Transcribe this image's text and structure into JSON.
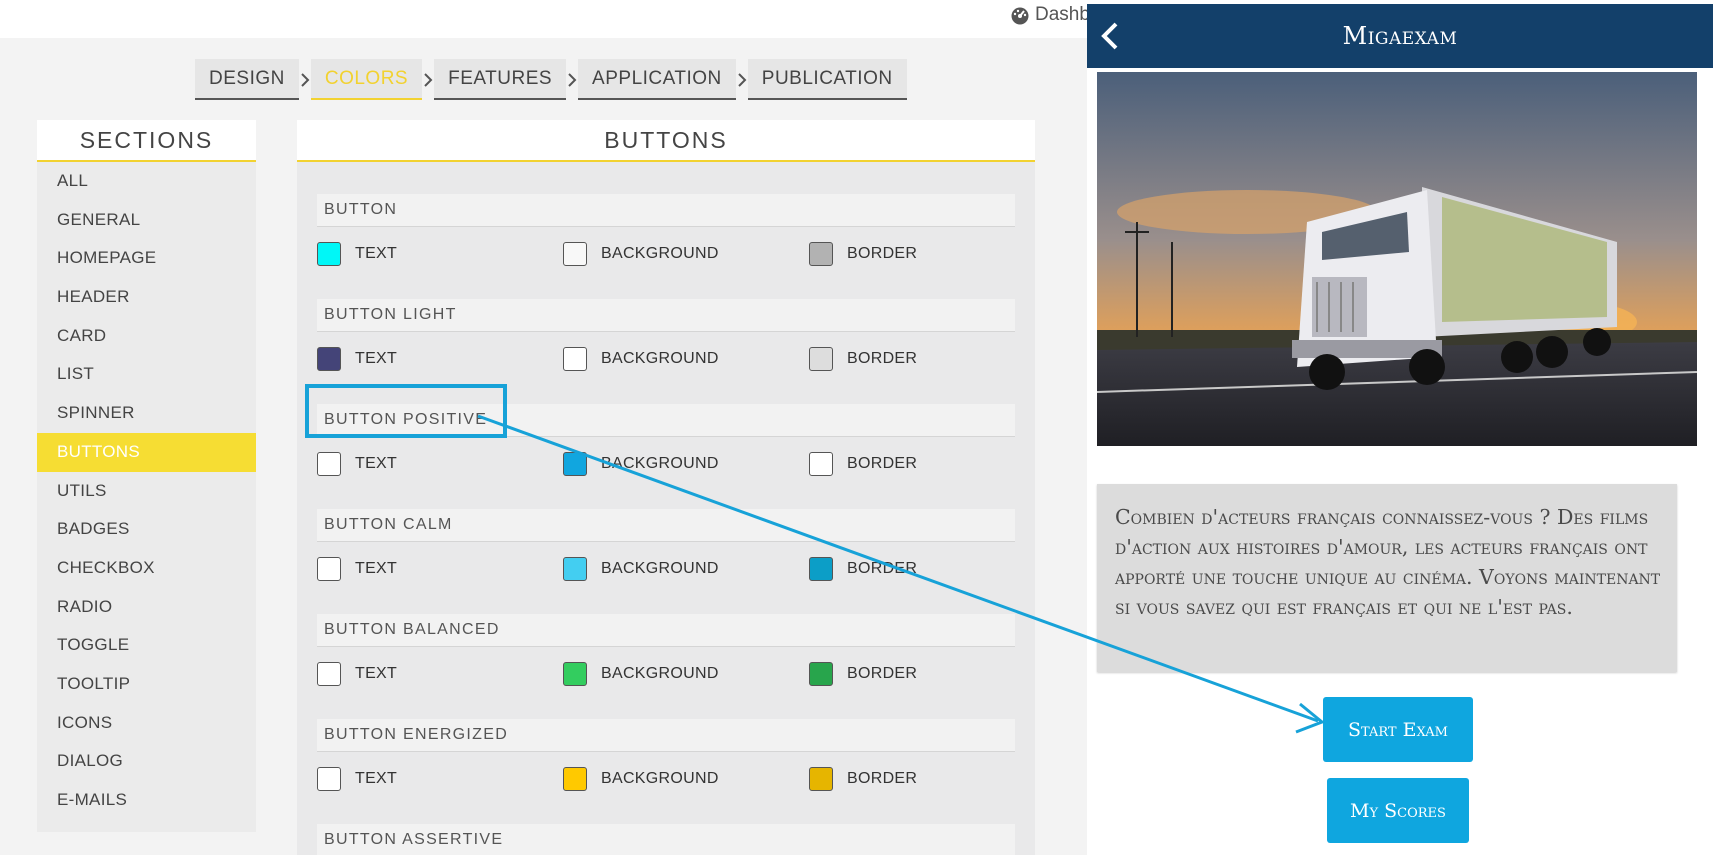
{
  "topbar": {
    "dashboard_label": "Dashb"
  },
  "steps": [
    {
      "label": "DESIGN",
      "active": false
    },
    {
      "label": "COLORS",
      "active": true
    },
    {
      "label": "FEATURES",
      "active": false
    },
    {
      "label": "APPLICATION",
      "active": false
    },
    {
      "label": "PUBLICATION",
      "active": false
    }
  ],
  "sections": {
    "title": "SECTIONS",
    "items": [
      "ALL",
      "GENERAL",
      "HOMEPAGE",
      "HEADER",
      "CARD",
      "LIST",
      "SPINNER",
      "BUTTONS",
      "UTILS",
      "BADGES",
      "CHECKBOX",
      "RADIO",
      "TOGGLE",
      "TOOLTIP",
      "ICONS",
      "DIALOG",
      "E-MAILS"
    ],
    "active": "BUTTONS"
  },
  "panel": {
    "title": "BUTTONS",
    "groups": [
      {
        "name": "BUTTON",
        "swatches": [
          {
            "label": "TEXT",
            "color": "#00f7f7"
          },
          {
            "label": "BACKGROUND",
            "color": "#f8f8f8"
          },
          {
            "label": "BORDER",
            "color": "#b2b2b2"
          }
        ]
      },
      {
        "name": "BUTTON LIGHT",
        "swatches": [
          {
            "label": "TEXT",
            "color": "#444478"
          },
          {
            "label": "BACKGROUND",
            "color": "#ffffff"
          },
          {
            "label": "BORDER",
            "color": "#dddddd"
          }
        ]
      },
      {
        "name": "BUTTON POSITIVE",
        "swatches": [
          {
            "label": "TEXT",
            "color": "#ffffff"
          },
          {
            "label": "BACKGROUND",
            "color": "#11a6df"
          },
          {
            "label": "BORDER",
            "color": "#ffffff"
          }
        ]
      },
      {
        "name": "BUTTON CALM",
        "swatches": [
          {
            "label": "TEXT",
            "color": "#ffffff"
          },
          {
            "label": "BACKGROUND",
            "color": "#43cef1"
          },
          {
            "label": "BORDER",
            "color": "#0c9ec7"
          }
        ]
      },
      {
        "name": "BUTTON BALANCED",
        "swatches": [
          {
            "label": "TEXT",
            "color": "#ffffff"
          },
          {
            "label": "BACKGROUND",
            "color": "#33cd5f"
          },
          {
            "label": "BORDER",
            "color": "#28a54c"
          }
        ]
      },
      {
        "name": "BUTTON ENERGIZED",
        "swatches": [
          {
            "label": "TEXT",
            "color": "#ffffff"
          },
          {
            "label": "BACKGROUND",
            "color": "#ffc900"
          },
          {
            "label": "BORDER",
            "color": "#e6b500"
          }
        ]
      },
      {
        "name": "BUTTON ASSERTIVE",
        "swatches": []
      }
    ]
  },
  "preview": {
    "title": "Migaexam",
    "description": "Combien d'acteurs français connaissez-vous ? Des films d'action aux histoires d'amour, les acteurs français ont apporté une touche unique au cinéma. Voyons maintenant si vous savez qui est français et qui ne l'est pas.",
    "start_button": "Start Exam",
    "scores_button": "My Scores",
    "hero_image": "truck-at-sunset"
  },
  "annotation": {
    "highlight_target": "BUTTON POSITIVE",
    "arrow_target": "Start Exam",
    "color": "#17a2d8"
  }
}
